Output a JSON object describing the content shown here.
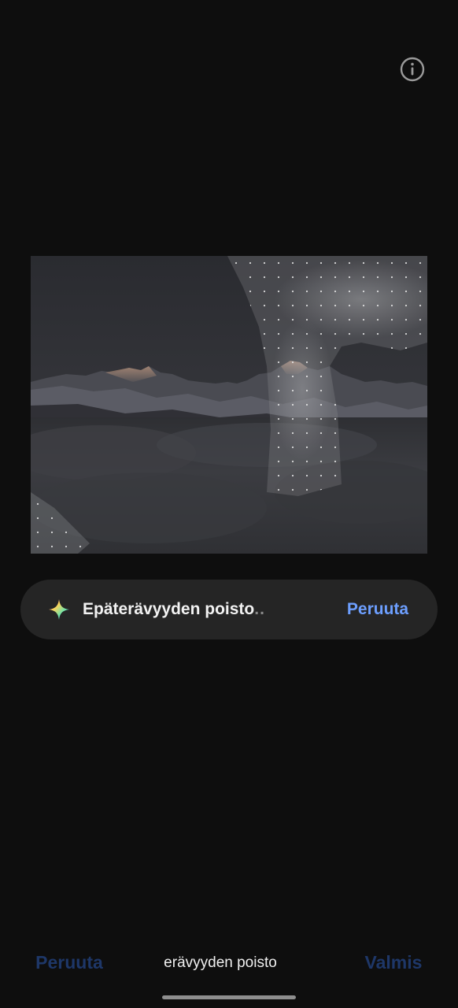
{
  "header": {
    "info_icon": "info-circle-icon"
  },
  "photo": {
    "subject": "mountain-landscape-image",
    "effect_overlay": "dotted-processing-overlay"
  },
  "progress": {
    "icon": "sparkle-icon",
    "label": "Epäterävyyden poisto",
    "ellipsis": "..",
    "cancel_label": "Peruuta"
  },
  "bottom_bar": {
    "cancel_label": "Peruuta",
    "mode_label": "erävyyden poisto",
    "done_label": "Valmis"
  },
  "colors": {
    "background": "#0e0e0e",
    "pill_background": "#252525",
    "accent_blue": "#6d9fff",
    "disabled_blue": "#1e3768"
  }
}
